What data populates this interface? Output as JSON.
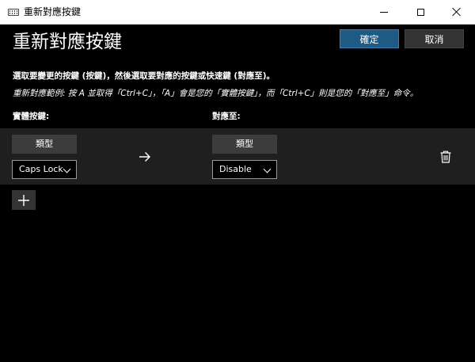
{
  "window": {
    "title": "重新對應按鍵",
    "icon": "keyboard-icon"
  },
  "header": {
    "title": "重新對應按鍵",
    "ok_label": "確定",
    "cancel_label": "取消"
  },
  "instructions": {
    "main": "選取要變更的按鍵 (按鍵)，然後選取要對應的按鍵或快速鍵 (對應至)。",
    "example": "重新對應範例: 按 A 並取得「Ctrl+C」，「A」會是您的「實體按鍵」，而「Ctrl+C」則是您的「對應至」命令。"
  },
  "columns": {
    "physical": "實體按鍵:",
    "mapped_to": "對應至:"
  },
  "mappings": [
    {
      "physical_type_label": "類型",
      "physical_key": "Caps Lock",
      "mapped_type_label": "類型",
      "mapped_key": "Disable"
    }
  ],
  "icons": {
    "arrow": "arrow-right-icon",
    "delete": "trash-icon",
    "add": "plus-icon"
  },
  "colors": {
    "background": "#000000",
    "accent_button": "#1f5a84",
    "secondary_button": "#333333",
    "row_background": "#1f1f1f"
  }
}
